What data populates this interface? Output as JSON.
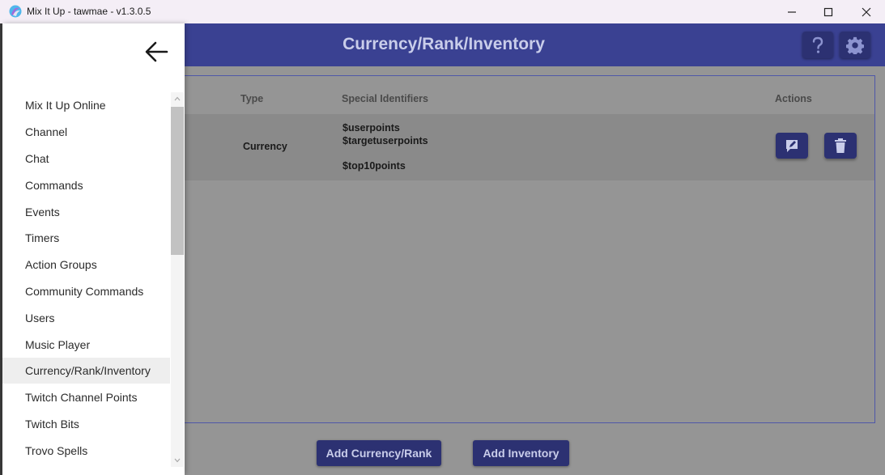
{
  "window": {
    "title": "Mix It Up - tawmae - v1.3.0.5",
    "icons": {
      "app": "mix-it-up-logo-icon",
      "minimize": "minimize-icon",
      "maximize": "maximize-icon",
      "close": "close-icon"
    }
  },
  "header": {
    "title": "Currency/Rank/Inventory",
    "help_icon": "help-icon",
    "settings_icon": "gear-icon",
    "color": "#3a4192"
  },
  "table": {
    "columns": [
      "Type",
      "Special Identifiers",
      "Actions"
    ],
    "rows": [
      {
        "type": "Currency",
        "identifiers": [
          "$userpoints",
          "$targetuserpoints",
          "$top10points"
        ],
        "actions": [
          "edit-icon",
          "trash-icon"
        ]
      }
    ]
  },
  "buttons": {
    "add_currency_rank": "Add Currency/Rank",
    "add_inventory": "Add Inventory"
  },
  "drawer": {
    "back_icon": "arrow-left-icon",
    "items": [
      {
        "label": "Mix It Up Online"
      },
      {
        "label": "Channel"
      },
      {
        "label": "Chat"
      },
      {
        "label": "Commands"
      },
      {
        "label": "Events"
      },
      {
        "label": "Timers"
      },
      {
        "label": "Action Groups"
      },
      {
        "label": "Community Commands"
      },
      {
        "label": "Users"
      },
      {
        "label": "Music Player"
      },
      {
        "label": "Currency/Rank/Inventory",
        "selected": true
      },
      {
        "label": "Twitch Channel Points"
      },
      {
        "label": "Twitch Bits"
      },
      {
        "label": "Trovo Spells"
      }
    ]
  },
  "colors": {
    "accent": "#2c3172",
    "header_text": "#c9cdea",
    "overlay": "#959595"
  }
}
